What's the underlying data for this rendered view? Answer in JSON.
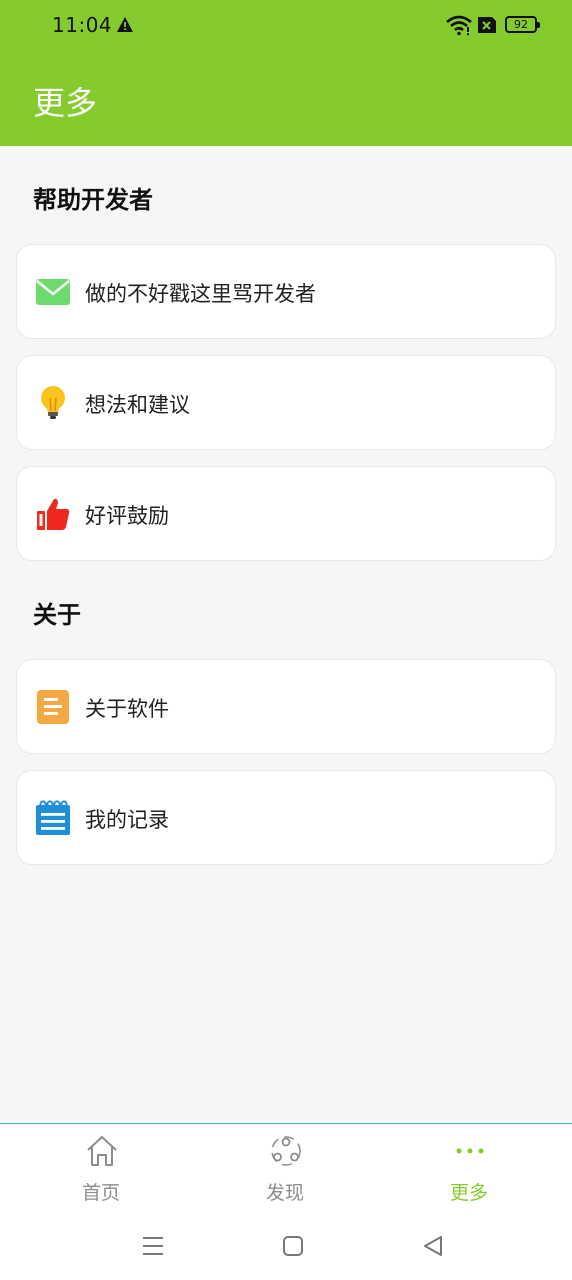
{
  "status_bar": {
    "time": "11:04",
    "battery": "92",
    "icons": [
      "warning-icon",
      "wifi-icon",
      "no-sim-icon",
      "battery-icon"
    ]
  },
  "app_bar": {
    "title": "更多"
  },
  "sections": {
    "help": {
      "title": "帮助开发者",
      "items": [
        {
          "label": "做的不好戳这里骂开发者",
          "icon": "mail-icon",
          "color": "#6ddb6d"
        },
        {
          "label": "想法和建议",
          "icon": "lightbulb-icon",
          "color": "#f7c51e"
        },
        {
          "label": "好评鼓励",
          "icon": "thumbs-up-icon",
          "color": "#ee2a1e"
        }
      ]
    },
    "about": {
      "title": "关于",
      "items": [
        {
          "label": "关于软件",
          "icon": "document-icon",
          "color": "#f5a742"
        },
        {
          "label": "我的记录",
          "icon": "notepad-icon",
          "color": "#1f8fd6"
        }
      ]
    }
  },
  "bottom_nav": {
    "items": [
      {
        "label": "首页",
        "icon": "home-icon",
        "active": false
      },
      {
        "label": "发现",
        "icon": "discover-icon",
        "active": false
      },
      {
        "label": "更多",
        "icon": "more-dots-icon",
        "active": true
      }
    ]
  },
  "colors": {
    "primary": "#85cb2d",
    "background": "#f5f6f8",
    "inactive_nav": "#8d8d8d"
  }
}
